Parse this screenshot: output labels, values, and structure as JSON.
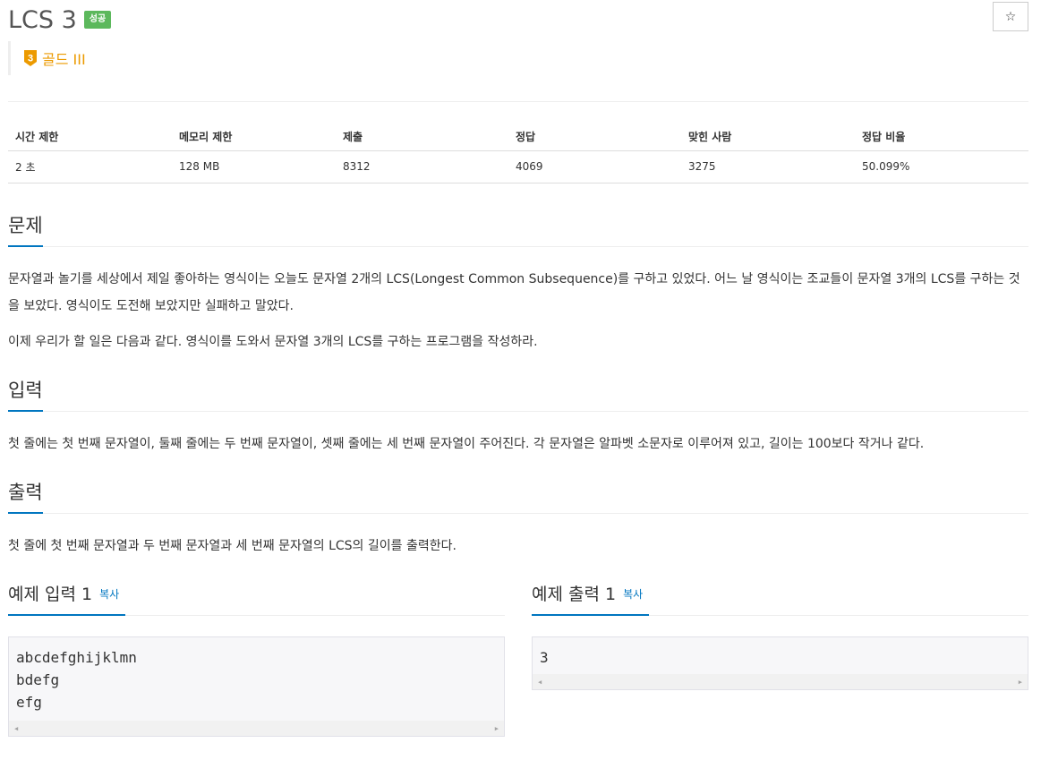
{
  "problem": {
    "title": "LCS 3",
    "status_badge": "성공",
    "star_icon": "☆",
    "tier_number": "3",
    "tier_label": "골드 III",
    "tier_color": "#ec9a00"
  },
  "info_table": {
    "headers": [
      "시간 제한",
      "메모리 제한",
      "제출",
      "정답",
      "맞힌 사람",
      "정답 비율"
    ],
    "values": [
      "2 초",
      "128 MB",
      "8312",
      "4069",
      "3275",
      "50.099%"
    ]
  },
  "sections": {
    "description": {
      "title": "문제",
      "paragraphs": [
        "문자열과 놀기를 세상에서 제일 좋아하는 영식이는 오늘도 문자열 2개의 LCS(Longest Common Subsequence)를 구하고 있었다. 어느 날 영식이는 조교들이 문자열 3개의 LCS를 구하는 것을 보았다. 영식이도 도전해 보았지만 실패하고 말았다.",
        "이제 우리가 할 일은 다음과 같다. 영식이를 도와서 문자열 3개의 LCS를 구하는 프로그램을 작성하라."
      ]
    },
    "input": {
      "title": "입력",
      "text": "첫 줄에는 첫 번째 문자열이, 둘째 줄에는 두 번째 문자열이, 셋째 줄에는 세 번째 문자열이 주어진다. 각 문자열은 알파벳 소문자로 이루어져 있고, 길이는 100보다 작거나 같다."
    },
    "output": {
      "title": "출력",
      "text": "첫 줄에 첫 번째 문자열과 두 번째 문자열과 세 번째 문자열의 LCS의 길이를 출력한다."
    }
  },
  "samples": {
    "input": {
      "title": "예제 입력 1",
      "copy_label": "복사",
      "content": "abcdefghijklmn\nbdefg\nefg"
    },
    "output": {
      "title": "예제 출력 1",
      "copy_label": "복사",
      "content": "3"
    }
  },
  "colors": {
    "accent": "#0076c0",
    "success": "#5cb85c"
  }
}
